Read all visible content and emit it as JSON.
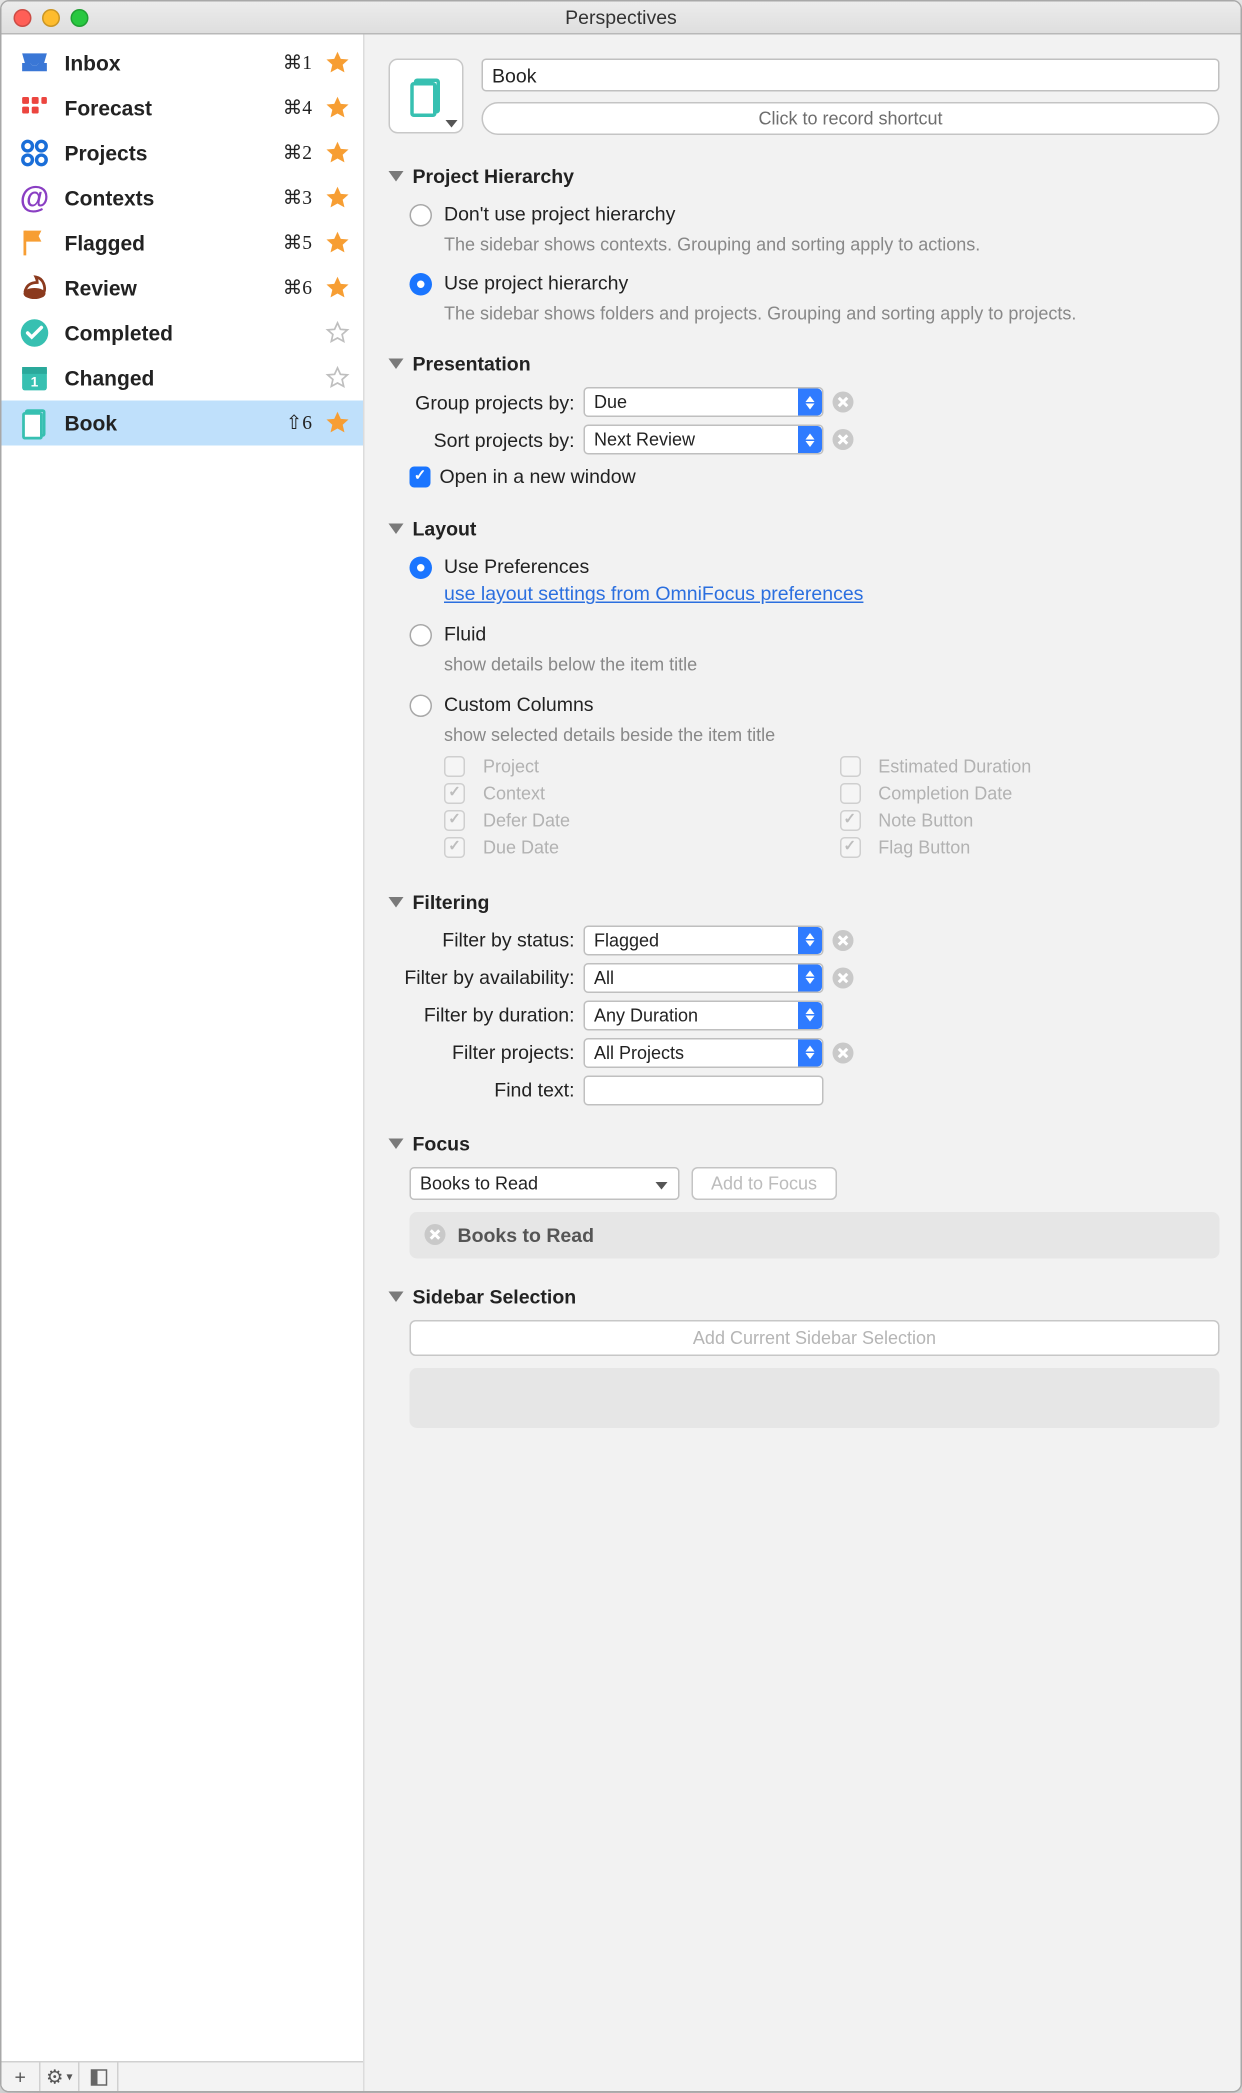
{
  "window": {
    "title": "Perspectives"
  },
  "colors": {
    "accent": "#f79e33",
    "teal": "#37c0b1",
    "blue": "#1a75ff",
    "red": "#ec453f"
  },
  "sidebar": {
    "items": [
      {
        "name": "Inbox",
        "shortcut": "⌘1",
        "starred": true,
        "icon": "inbox"
      },
      {
        "name": "Forecast",
        "shortcut": "⌘4",
        "starred": true,
        "icon": "forecast"
      },
      {
        "name": "Projects",
        "shortcut": "⌘2",
        "starred": true,
        "icon": "projects"
      },
      {
        "name": "Contexts",
        "shortcut": "⌘3",
        "starred": true,
        "icon": "contexts"
      },
      {
        "name": "Flagged",
        "shortcut": "⌘5",
        "starred": true,
        "icon": "flag"
      },
      {
        "name": "Review",
        "shortcut": "⌘6",
        "starred": true,
        "icon": "review"
      },
      {
        "name": "Completed",
        "shortcut": "",
        "starred": false,
        "icon": "completed"
      },
      {
        "name": "Changed",
        "shortcut": "",
        "starred": false,
        "icon": "changed"
      },
      {
        "name": "Book",
        "shortcut": "⇧6",
        "starred": true,
        "icon": "book",
        "selected": true
      }
    ]
  },
  "toolbar": {
    "add": "+",
    "gear": "⚙",
    "collapse": "⇤"
  },
  "editor": {
    "name_value": "Book",
    "record_shortcut": "Click to record shortcut",
    "project_hierarchy": {
      "title": "Project Hierarchy",
      "opt_no": "Don't use project hierarchy",
      "opt_no_desc": "The sidebar shows contexts. Grouping and sorting apply to actions.",
      "opt_yes": "Use project hierarchy",
      "opt_yes_desc": "The sidebar shows folders and projects. Grouping and sorting apply to projects.",
      "selected": "yes"
    },
    "presentation": {
      "title": "Presentation",
      "group_label": "Group projects by:",
      "group_value": "Due",
      "sort_label": "Sort projects by:",
      "sort_value": "Next Review",
      "open_new_window_label": "Open in a new window",
      "open_new_window_checked": true
    },
    "layout": {
      "title": "Layout",
      "prefs_label": "Use Preferences",
      "prefs_link": "use layout settings from OmniFocus preferences",
      "fluid_label": "Fluid",
      "fluid_desc": "show details below the item title",
      "columns_label": "Custom Columns",
      "columns_desc": "show selected details beside the item title",
      "selected": "prefs",
      "columns": {
        "project": "Project",
        "context": "Context",
        "defer": "Defer Date",
        "due": "Due Date",
        "est": "Estimated Duration",
        "completion": "Completion Date",
        "note": "Note Button",
        "flag": "Flag Button"
      }
    },
    "filtering": {
      "title": "Filtering",
      "status_label": "Filter by status:",
      "status_value": "Flagged",
      "avail_label": "Filter by availability:",
      "avail_value": "All",
      "dur_label": "Filter by duration:",
      "dur_value": "Any Duration",
      "proj_label": "Filter projects:",
      "proj_value": "All Projects",
      "find_label": "Find text:",
      "find_value": ""
    },
    "focus": {
      "title": "Focus",
      "combo_value": "Books to Read",
      "add_button": "Add to Focus",
      "token": "Books to Read"
    },
    "sidebar_sel": {
      "title": "Sidebar Selection",
      "add_button": "Add Current Sidebar Selection"
    }
  }
}
